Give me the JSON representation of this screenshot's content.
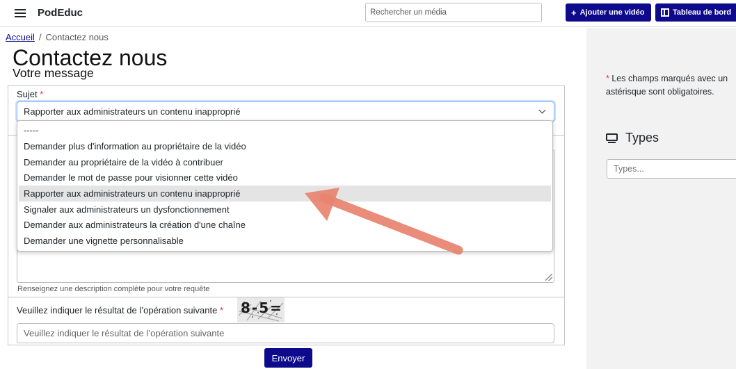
{
  "header": {
    "brand": "PodEduc",
    "search_placeholder": "Rechercher un média",
    "add_video_label": "Ajouter une vidéo",
    "dashboard_label": "Tableau de bord"
  },
  "breadcrumb": {
    "home": "Accueil",
    "separator": "/",
    "current": "Contactez nous"
  },
  "page": {
    "title": "Contactez nous",
    "section": "Votre message"
  },
  "form": {
    "subject_label": "Sujet",
    "required_mark": "*",
    "subject_value": "Rapporter aux administrateurs un contenu inapproprié",
    "subject_options": [
      "-----",
      "Demander plus d'information au propriétaire de la vidéo",
      "Demander au propriétaire de la vidéo à contribuer",
      "Demander le mot de passe pour visionner cette vidéo",
      "Rapporter aux administrateurs un contenu inapproprié",
      "Signaler aux administrateurs un dysfonctionnement",
      "Demander aux administrateurs la création d'une chaîne",
      "Demander une vignette personnalisable"
    ],
    "selected_option_index": 4,
    "description_help": "Renseignez une description complète pour votre requête",
    "captcha_label": "Veuillez indiquer le résultat de l’opération suivante",
    "captcha_text": "8-5=",
    "captcha_placeholder": "Veuillez indiquer le résultat de l’opération suivante",
    "submit_label": "Envoyer"
  },
  "sidebar": {
    "required_star": "*",
    "required_note": "Les champs marqués avec un astérisque sont obligatoires.",
    "types_title": "Types",
    "types_placeholder": "Types..."
  },
  "icons": {
    "menu": "hamburger-icon",
    "add": "plus-icon",
    "dashboard": "film-icon",
    "types": "monitor-icon",
    "select": "chevron-down-icon"
  },
  "colors": {
    "primary": "#0d0b8c",
    "required": "#d9363e",
    "annotation_arrow": "#e8836f"
  }
}
